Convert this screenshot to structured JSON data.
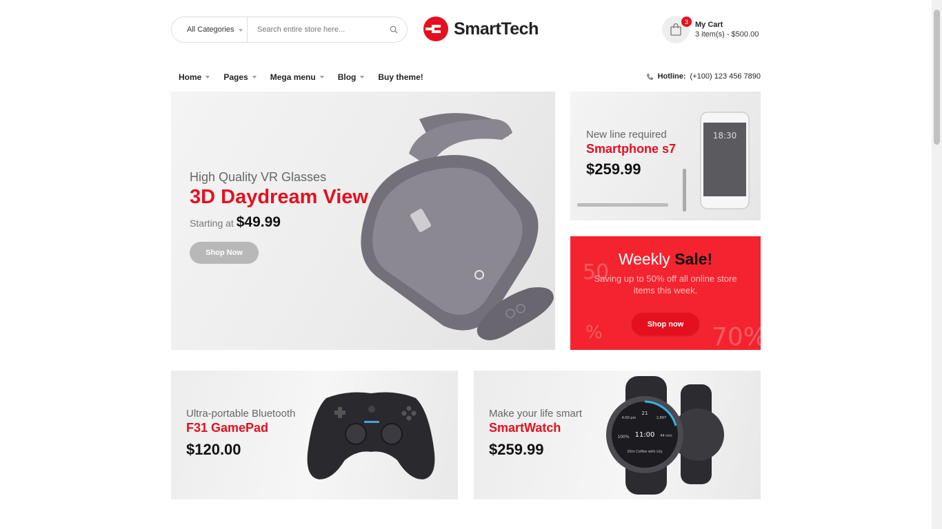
{
  "header": {
    "category_label": "All Categories",
    "search_placeholder": "Search entire store here...",
    "logo_text": "SmartTech",
    "cart": {
      "badge": "3",
      "title": "My Cart",
      "summary": "3 item(s) - $500.00"
    }
  },
  "nav": {
    "items": [
      {
        "label": "Home"
      },
      {
        "label": "Pages"
      },
      {
        "label": "Mega menu"
      },
      {
        "label": "Blog"
      },
      {
        "label": "Buy theme!"
      }
    ],
    "hotline_label": "Hotline:",
    "hotline_number": "(+100) 123 456 7890"
  },
  "banners": {
    "main": {
      "subtitle": "High Quality VR Glasses",
      "title": "3D Daydream View",
      "starting_label": "Starting at",
      "price": "$49.99",
      "button": "Shop Now"
    },
    "phone": {
      "subtitle": "New line required",
      "title": "Smartphone s7",
      "price": "$259.99",
      "screen_time": "18:30"
    },
    "sale": {
      "title_a": "Weekly",
      "title_b": "Sale!",
      "description": "Saving up to 50% off all online store items this week.",
      "button": "Shop now"
    },
    "gamepad": {
      "subtitle": "Ultra-portable Bluetooth",
      "title": "F31 GamePad",
      "price": "$120.00"
    },
    "watch": {
      "subtitle": "Make your life smart",
      "title": "SmartWatch",
      "price": "$259.99",
      "watch_time": "11:00",
      "watch_date": "21",
      "watch_left_top": "4:00 pm",
      "watch_right_top": "2,897",
      "watch_left": "100%",
      "watch_right": "44 min",
      "watch_bottom": "20m Coffee with Lily"
    }
  },
  "colors": {
    "accent": "#e4101f",
    "sale_bg": "#f3242f"
  }
}
